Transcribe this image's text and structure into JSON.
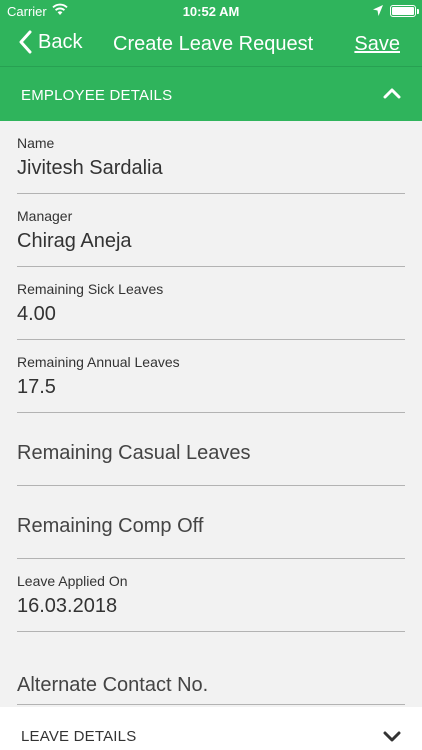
{
  "status_bar": {
    "carrier": "Carrier",
    "time": "10:52 AM"
  },
  "nav": {
    "back_label": "Back",
    "title": "Create Leave Request",
    "save_label": "Save"
  },
  "employee_section": {
    "header": "EMPLOYEE DETAILS",
    "fields": [
      {
        "label": "Name",
        "value": "Jivitesh Sardalia"
      },
      {
        "label": "Manager",
        "value": "Chirag Aneja"
      },
      {
        "label": "Remaining Sick Leaves",
        "value": "4.00"
      },
      {
        "label": "Remaining Annual Leaves",
        "value": "17.5"
      },
      {
        "placeholder": "Remaining Casual Leaves"
      },
      {
        "placeholder": "Remaining Comp Off"
      },
      {
        "label": "Leave Applied On",
        "value": "16.03.2018"
      },
      {
        "placeholder": "Alternate Contact No."
      }
    ]
  },
  "leave_section": {
    "header": "LEAVE DETAILS"
  },
  "colors": {
    "brand_green": "#2fb45c",
    "background": "#f2f2f2"
  }
}
